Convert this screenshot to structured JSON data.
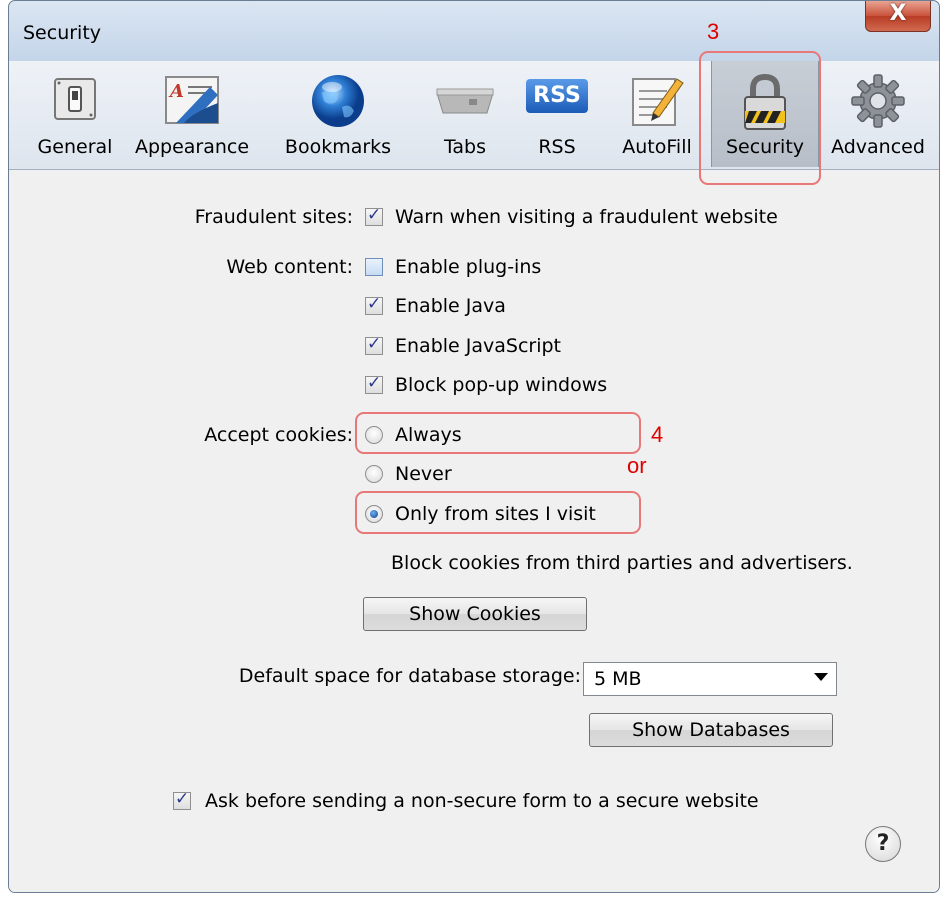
{
  "window": {
    "title": "Security",
    "close_label": "X"
  },
  "toolbar": {
    "items": [
      {
        "label": "General",
        "icon": "switch-icon"
      },
      {
        "label": "Appearance",
        "icon": "text-style-icon"
      },
      {
        "label": "Bookmarks",
        "icon": "globe-icon"
      },
      {
        "label": "Tabs",
        "icon": "tabs-icon"
      },
      {
        "label": "RSS",
        "icon": "rss-icon",
        "icon_text": "RSS"
      },
      {
        "label": "AutoFill",
        "icon": "pencil-form-icon"
      },
      {
        "label": "Security",
        "icon": "padlock-icon",
        "active": true
      },
      {
        "label": "Advanced",
        "icon": "gear-icon"
      }
    ]
  },
  "fraudulent": {
    "label": "Fraudulent sites:",
    "option": "Warn when visiting a fraudulent website",
    "checked": true
  },
  "web_content": {
    "label": "Web content:",
    "options": [
      {
        "text": "Enable plug-ins",
        "checked": false
      },
      {
        "text": "Enable Java",
        "checked": true
      },
      {
        "text": "Enable JavaScript",
        "checked": true
      },
      {
        "text": "Block pop-up windows",
        "checked": true
      }
    ]
  },
  "cookies": {
    "label": "Accept cookies:",
    "options": [
      {
        "text": "Always",
        "selected": false
      },
      {
        "text": "Never",
        "selected": false
      },
      {
        "text": "Only from sites I visit",
        "selected": true
      }
    ],
    "note": "Block cookies from third parties and advertisers.",
    "show_button": "Show Cookies"
  },
  "database": {
    "label": "Default space for database storage:",
    "value": "5 MB",
    "show_button": "Show Databases"
  },
  "nonsecure": {
    "text": "Ask before sending a non-secure form to a secure website",
    "checked": true
  },
  "help": "?",
  "annotations": {
    "step3": "3",
    "step4": "4",
    "or": "or"
  },
  "colors": {
    "annotation": "#e00000",
    "annotation_border": "#e87878"
  }
}
